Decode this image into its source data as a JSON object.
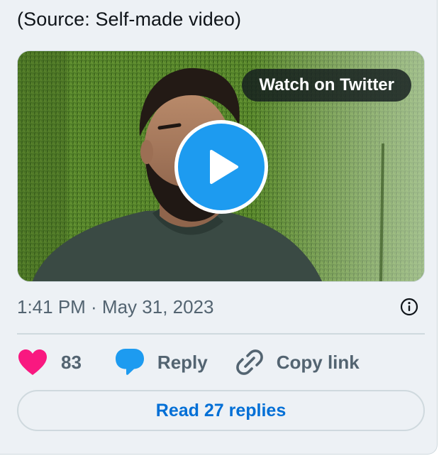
{
  "source_caption": "(Source: Self-made video)",
  "video": {
    "watch_label": "Watch on Twitter",
    "play_icon": "play-icon"
  },
  "timestamp": "1:41 PM · May 31, 2023",
  "actions": {
    "likes_count": "83",
    "reply_label": "Reply",
    "copy_label": "Copy link"
  },
  "read_replies_label": "Read 27 replies",
  "icons": {
    "info": "info-icon",
    "like": "heart-icon",
    "reply": "chat-bubble-icon",
    "copy": "link-icon"
  },
  "colors": {
    "card_bg": "#edf1f5",
    "accent": "#1d9bf0",
    "like": "#f91880",
    "link_text": "#006fd6",
    "muted_text": "#536471",
    "border": "#cfd9de"
  }
}
